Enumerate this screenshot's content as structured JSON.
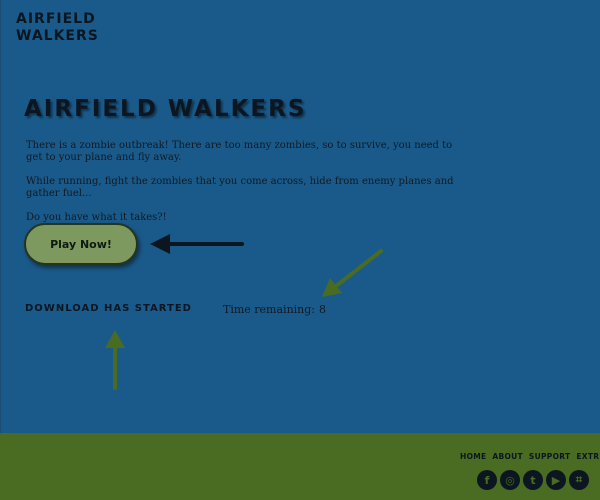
{
  "logo": {
    "line1": "AIRFIELD",
    "line2": "WALKERS"
  },
  "hero": {
    "title": "AIRFIELD WALKERS"
  },
  "intro": {
    "paragraphs": [
      "There is a zombie outbreak! There are too many zombies, so to survive, you need to get to your plane and fly away.",
      "While running, fight the zombies that you come across, hide from enemy planes and gather fuel...",
      "Do you have what it takes?!"
    ]
  },
  "play_button": {
    "label": "Play Now!"
  },
  "download": {
    "status": "DOWNLOAD HAS STARTED"
  },
  "timer": {
    "label": "Time remaining:",
    "value": "8"
  },
  "footer": {
    "nav": [
      "HOME",
      "ABOUT",
      "SUPPORT",
      "EXTR"
    ],
    "social": [
      {
        "icon": "facebook-icon",
        "glyph": "f"
      },
      {
        "icon": "instagram-icon",
        "glyph": "◎"
      },
      {
        "icon": "twitter-icon",
        "glyph": "t"
      },
      {
        "icon": "youtube-icon",
        "glyph": "▶"
      },
      {
        "icon": "twitch-icon",
        "glyph": "⌗"
      }
    ]
  },
  "colors": {
    "background": "#1a5a8a",
    "footer": "#4a6b22",
    "button": "#7d9960",
    "arrow_green": "#4a6b22",
    "arrow_black": "#0c1620"
  }
}
